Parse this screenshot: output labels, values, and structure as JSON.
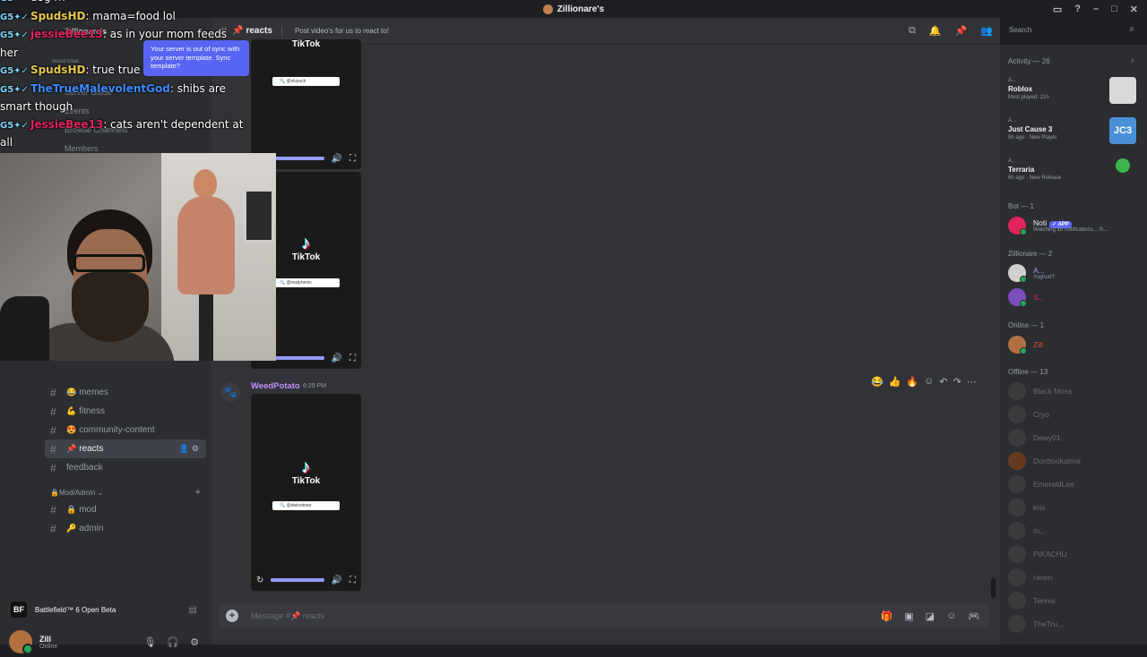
{
  "window": {
    "title": "Zillionare's"
  },
  "server": {
    "name": "Zillionare's",
    "boost_goal": "Boost Goal",
    "menu": [
      "Server Guide",
      "Events",
      "Browse Channels",
      "Members"
    ],
    "sync_tooltip": "Your server is out of sync with your server template. Sync template?"
  },
  "channels": [
    {
      "emoji": "😂",
      "name": "memes"
    },
    {
      "emoji": "💪",
      "name": "fitness"
    },
    {
      "emoji": "😍",
      "name": "community-content"
    },
    {
      "emoji": "📌",
      "name": "reacts",
      "active": true
    },
    {
      "emoji": "",
      "name": "feedback"
    }
  ],
  "category": {
    "name": "Mod/Admin",
    "channels": [
      {
        "emoji": "🔒",
        "name": "mod"
      },
      {
        "emoji": "🔑",
        "name": "admin"
      }
    ]
  },
  "activity_bar": {
    "game": "Battlefield™ 6 Open Beta",
    "logo": "BF"
  },
  "user": {
    "name": "Zill",
    "status": "Online"
  },
  "stream_chat": [
    {
      "badge": "G5",
      "name": "",
      "text": "dog rn",
      "color": "#ffffff"
    },
    {
      "badge": "G5",
      "name": "SpudsHD",
      "text": ": mama=food lol",
      "color": "#e6c84d"
    },
    {
      "badge": "G5",
      "name": "jessieBee13",
      "text": ": as in your mom feeds",
      "color": "#e0245e"
    },
    {
      "badge": "",
      "name": "",
      "text": "her",
      "color": "#ffffff"
    },
    {
      "badge": "G5",
      "name": "SpudsHD",
      "text": ": true true",
      "color": "#e6c84d"
    },
    {
      "badge": "G5",
      "name": "TheTrueMalevolentGod",
      "text": ": shibs are",
      "color": "#3d8bff"
    },
    {
      "badge": "",
      "name": "",
      "text": "smart though",
      "color": "#ffffff"
    },
    {
      "badge": "G5",
      "name": "JessieBee13",
      "text": ": cats aren't dependent at",
      "color": "#e0245e"
    },
    {
      "badge": "",
      "name": "",
      "text": "all",
      "color": "#ffffff"
    }
  ],
  "header": {
    "channel": "reacts",
    "topic": "Post video's for us to react to!"
  },
  "search": {
    "placeholder": "Search"
  },
  "message": {
    "author": "WeedPotato",
    "time": "6:29 PM"
  },
  "videos": [
    {
      "brand": "TikTok",
      "handle": "@vlvpuck"
    },
    {
      "brand": "TikTok",
      "handle": "@realphenix"
    },
    {
      "brand": "TikTok",
      "handle": "@dwindmee"
    }
  ],
  "composer": {
    "placeholder": "Message #📌 reacts"
  },
  "members": {
    "activity_header": "Activity — 26",
    "activities": [
      {
        "user": "A...",
        "game": "Roblox",
        "meta": "Most played: 21h",
        "color": "#d9d9d9"
      },
      {
        "user": "A...",
        "game": "Just Cause 3",
        "meta": "5h ago · New Player",
        "color": "#4a90d9",
        "art": "JC3"
      },
      {
        "user": "A...",
        "game": "Terraria",
        "meta": "6h ago · New Release",
        "color": "#2b2d31"
      }
    ],
    "bot_header": "Bot — 1",
    "bot": {
      "name": "Noti",
      "badge": "✓ APP",
      "sub": "Watching for notifications... /h..."
    },
    "role_header": "Zillionare — 2",
    "role_members": [
      {
        "name": "A...",
        "sub": "Yoghurt?"
      },
      {
        "name": "S...",
        "sub": ""
      }
    ],
    "online_header": "Online — 1",
    "online": [
      {
        "name": "Zill"
      }
    ],
    "offline_header": "Offline — 13",
    "offline": [
      "Black Moss",
      "Cryo",
      "Dewy01",
      "Donttookatme",
      "EmeraldLee",
      "kris",
      "m...",
      "PIKACHU",
      "raven",
      "Tennis",
      "TheTru..."
    ]
  }
}
